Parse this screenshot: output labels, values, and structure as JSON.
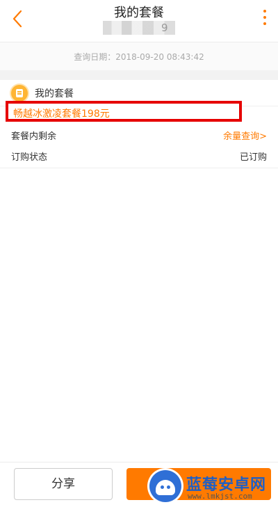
{
  "header": {
    "title": "我的套餐",
    "subtitle_tail": "9"
  },
  "query": {
    "label": "查询日期：2018-09-20 08:43:42"
  },
  "section": {
    "title": "我的套餐",
    "plan_name": "畅越冰激凌套餐198元",
    "rows": [
      {
        "label": "套餐内剩余",
        "value": "余量查询>"
      },
      {
        "label": "订购状态",
        "value": "已订购"
      }
    ]
  },
  "bottom": {
    "share_label": "分享"
  },
  "watermark": {
    "title": "蓝莓安卓网",
    "url": "www.lmkjst.com"
  },
  "colors": {
    "accent": "#ff7a00",
    "highlight_border": "#e60000"
  }
}
